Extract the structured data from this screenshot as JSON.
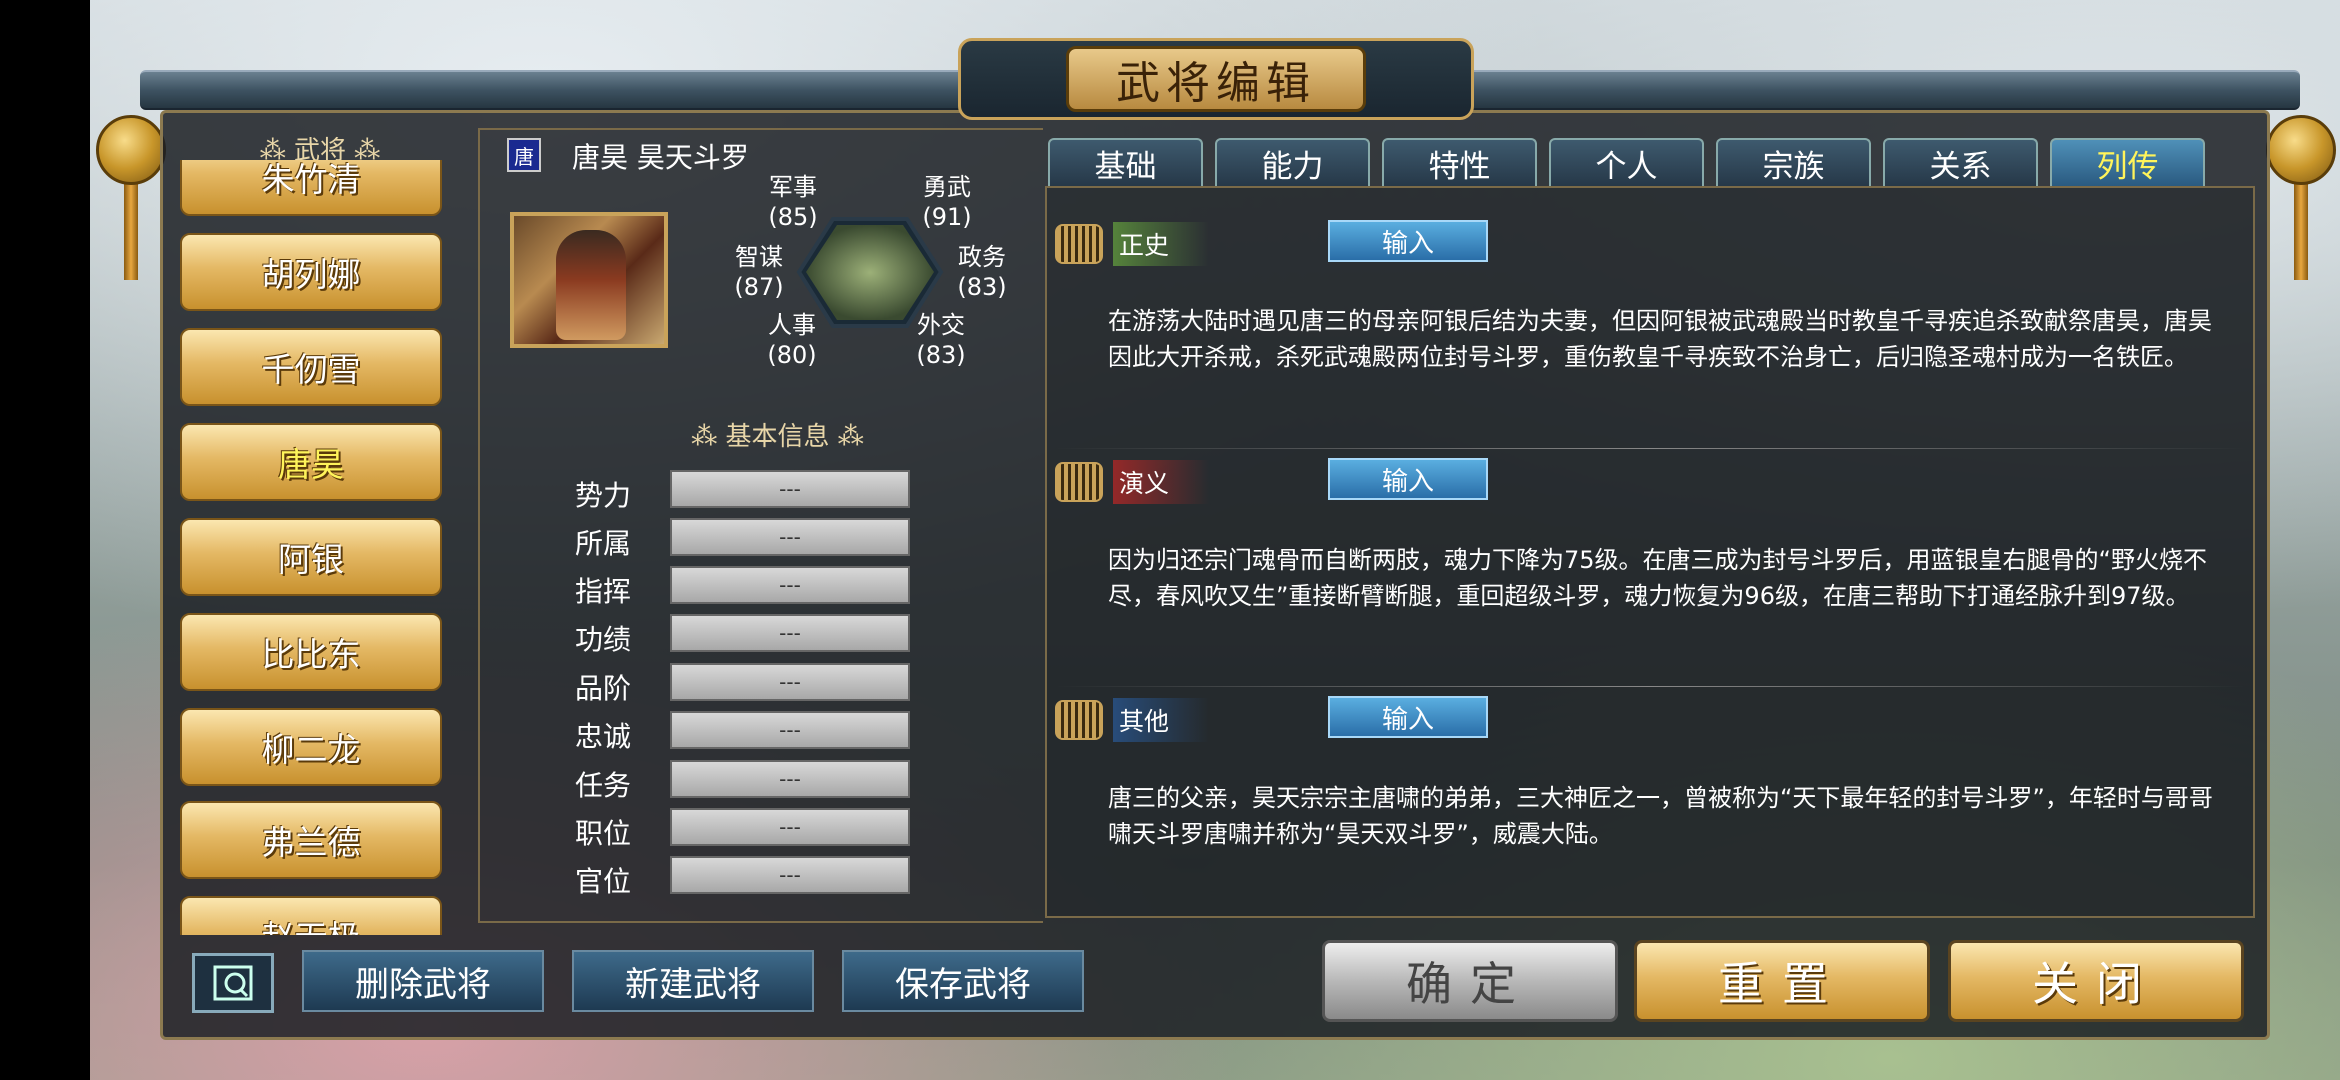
{
  "window": {
    "title": "武将编辑"
  },
  "list": {
    "header": "武将",
    "items": [
      {
        "label": "朱竹清",
        "active": false
      },
      {
        "label": "胡列娜",
        "active": false
      },
      {
        "label": "千仞雪",
        "active": false
      },
      {
        "label": "唐昊",
        "active": true
      },
      {
        "label": "阿银",
        "active": false
      },
      {
        "label": "比比东",
        "active": false
      },
      {
        "label": "柳二龙",
        "active": false
      },
      {
        "label": "弗兰德",
        "active": false
      },
      {
        "label": "赵无极",
        "active": false
      }
    ]
  },
  "hero": {
    "badge": "唐",
    "name": "唐昊  昊天斗罗",
    "stats": [
      {
        "label": "军事",
        "value": "(85)"
      },
      {
        "label": "勇武",
        "value": "(91)"
      },
      {
        "label": "政务",
        "value": "(83)"
      },
      {
        "label": "外交",
        "value": "(83)"
      },
      {
        "label": "人事",
        "value": "(80)"
      },
      {
        "label": "智谋",
        "value": "(87)"
      }
    ]
  },
  "basic_info": {
    "title": "基本信息",
    "rows": [
      {
        "label": "势力",
        "value": "---"
      },
      {
        "label": "所属",
        "value": "---"
      },
      {
        "label": "指挥",
        "value": "---"
      },
      {
        "label": "功绩",
        "value": "---"
      },
      {
        "label": "品阶",
        "value": "---"
      },
      {
        "label": "忠诚",
        "value": "---"
      },
      {
        "label": "任务",
        "value": "---"
      },
      {
        "label": "职位",
        "value": "---"
      },
      {
        "label": "官位",
        "value": "---"
      }
    ]
  },
  "tabs": [
    {
      "label": "基础",
      "active": false
    },
    {
      "label": "能力",
      "active": false
    },
    {
      "label": "特性",
      "active": false
    },
    {
      "label": "个人",
      "active": false
    },
    {
      "label": "宗族",
      "active": false
    },
    {
      "label": "关系",
      "active": false
    },
    {
      "label": "列传",
      "active": true
    }
  ],
  "sections": [
    {
      "tag": "正史",
      "button": "输入",
      "text": "在游荡大陆时遇见唐三的母亲阿银后结为夫妻，但因阿银被武魂殿当时教皇千寻疾追杀致献祭唐昊，唐昊因此大开杀戒，杀死武魂殿两位封号斗罗，重伤教皇千寻疾致不治身亡，后归隐圣魂村成为一名铁匠。"
    },
    {
      "tag": "演义",
      "button": "输入",
      "text": "因为归还宗门魂骨而自断两肢，魂力下降为75级。在唐三成为封号斗罗后，用蓝银皇右腿骨的“野火烧不尽，春风吹又生”重接断臂断腿，重回超级斗罗，魂力恢复为96级，在唐三帮助下打通经脉升到97级。"
    },
    {
      "tag": "其他",
      "button": "输入",
      "text": "唐三的父亲，昊天宗宗主唐啸的弟弟，三大神匠之一，曾被称为“天下最年轻的封号斗罗”，年轻时与哥哥啸天斗罗唐啸并称为“昊天双斗罗”，威震大陆。"
    }
  ],
  "bottom": {
    "delete": "删除武将",
    "new": "新建武将",
    "save": "保存武将",
    "confirm": "确定",
    "reset": "重置",
    "close": "关闭"
  },
  "colors": {
    "gold": "#e4b864",
    "active_text": "#fff45a",
    "tab_blue": "#2a5a80",
    "input_blue": "#2a6ea8"
  }
}
